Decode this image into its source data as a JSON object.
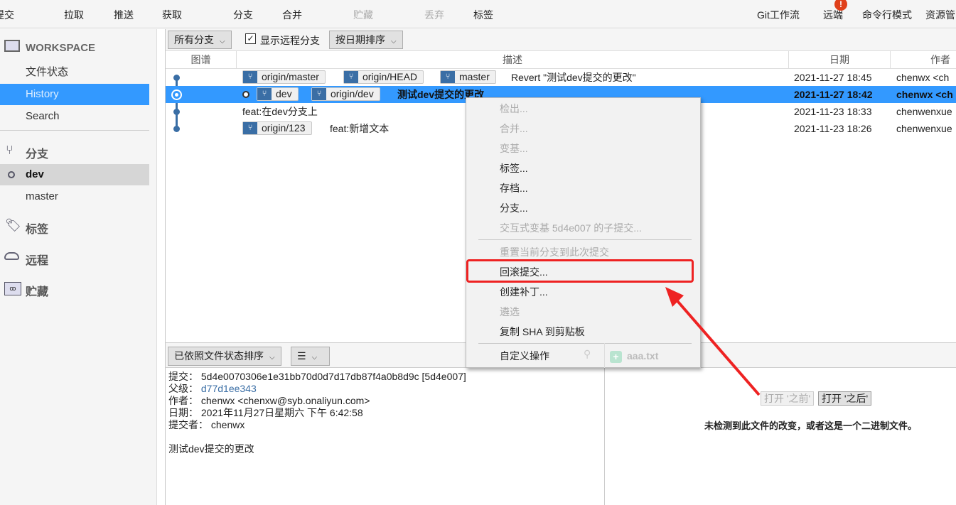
{
  "toolbar": {
    "items": [
      {
        "label": "提交",
        "disabled": false
      },
      {
        "label": "拉取",
        "disabled": false
      },
      {
        "label": "推送",
        "disabled": false
      },
      {
        "label": "获取",
        "disabled": false
      },
      {
        "label": "分支",
        "disabled": false
      },
      {
        "label": "合并",
        "disabled": false
      },
      {
        "label": "贮藏",
        "disabled": true
      },
      {
        "label": "丢弃",
        "disabled": true
      },
      {
        "label": "标签",
        "disabled": false
      },
      {
        "label": "Git工作流",
        "disabled": false
      },
      {
        "label": "远端",
        "disabled": false,
        "badge": "!"
      },
      {
        "label": "命令行模式",
        "disabled": false
      },
      {
        "label": "资源管"
      }
    ]
  },
  "sidebar": {
    "workspace": "WORKSPACE",
    "items": [
      "文件状态",
      "History",
      "Search"
    ],
    "active": "History",
    "branches_header": "分支",
    "branches": [
      "dev",
      "master"
    ],
    "current_branch": "dev",
    "tags": "标签",
    "remotes": "远程",
    "stashes": "贮藏"
  },
  "filter": {
    "branches": "所有分支",
    "show_remote": "显示远程分支",
    "show_remote_checked": true,
    "sort": "按日期排序"
  },
  "columns": {
    "graph": "图谱",
    "desc": "描述",
    "date": "日期",
    "author": "作者"
  },
  "commits": [
    {
      "refs": [
        "origin/master",
        "origin/HEAD",
        "master"
      ],
      "message": "Revert \"测试dev提交的更改\"",
      "date": "2021-11-27 18:45",
      "author": "chenwx <ch"
    },
    {
      "refs": [
        "dev",
        "origin/dev"
      ],
      "message": "测试dev提交的更改",
      "date": "2021-11-27 18:42",
      "author": "chenwx <ch",
      "selected": true,
      "head": true
    },
    {
      "refs": [],
      "message": "feat:在dev分支上",
      "date": "2021-11-23 18:33",
      "author": "chenwenxue"
    },
    {
      "refs": [
        "origin/123"
      ],
      "message": "feat:新增文本",
      "date": "2021-11-23 18:26",
      "author": "chenwenxue"
    }
  ],
  "context_menu": {
    "items": [
      {
        "label": "检出...",
        "disabled": true
      },
      {
        "label": "合并...",
        "disabled": true
      },
      {
        "label": "变基...",
        "disabled": true
      },
      {
        "label": "标签...",
        "disabled": false
      },
      {
        "label": "存档...",
        "disabled": false
      },
      {
        "label": "分支...",
        "disabled": false
      },
      {
        "label": "交互式变基 5d4e007 的子提交...",
        "disabled": true
      },
      {
        "label": "重置当前分支到此次提交",
        "disabled": true
      },
      {
        "label": "回滚提交...",
        "disabled": false,
        "highlighted": true
      },
      {
        "label": "创建补丁...",
        "disabled": false
      },
      {
        "label": "遴选",
        "disabled": true
      },
      {
        "label": "复制 SHA 到剪贴板",
        "disabled": false
      },
      {
        "label": "自定义操作",
        "disabled": false
      }
    ]
  },
  "lower": {
    "sort": "已依照文件状态排序",
    "view": "☰",
    "file": "aaa.txt",
    "details": {
      "commit_label": "提交：",
      "commit": "5d4e0070306e1e31bb70d0d7d17db87f4a0b8d9c [5d4e007]",
      "parent_label": "父级：",
      "parent": "d77d1ee343",
      "author_label": "作者：",
      "author": "chenwx <chenxw@syb.onaliyun.com>",
      "date_label": "日期：",
      "date": "2021年11月27日星期六 下午 6:42:58",
      "committer_label": "提交者：",
      "committer": "chenwx",
      "message": "测试dev提交的更改"
    },
    "open_before": "打开 '之前'",
    "open_after": "打开 '之后'",
    "no_change": "未检测到此文件的改变，或者这是一个二进制文件。"
  },
  "colors": {
    "accent": "#3399ff",
    "highlight_box": "#ee2222",
    "ref_icon": "#3a6ea5"
  }
}
